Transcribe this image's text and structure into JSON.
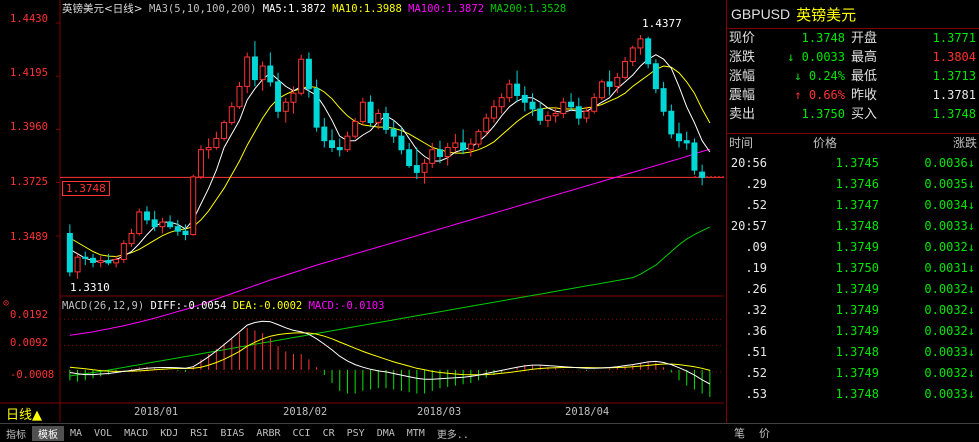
{
  "main_legend": {
    "symbol": "英镑美元",
    "period": "<日线>",
    "ma_params": "MA3(5,10,100,200)",
    "ma5": "MA5:1.3872",
    "ma10": "MA10:1.3988",
    "ma100": "MA100:1.3872",
    "ma200": "MA200:1.3528"
  },
  "y_axis_labels": [
    "1.4430",
    "1.4195",
    "1.3960",
    "1.3725",
    "1.3489"
  ],
  "macd_axis_labels": [
    "0.0192",
    "0.0092",
    "-0.0008"
  ],
  "x_axis_labels": [
    "2018/01",
    "2018/02",
    "2018/03",
    "2018/04"
  ],
  "annotations": {
    "high": "1.4377",
    "low": "1.3310",
    "current_line": "1.3748"
  },
  "macd_legend": {
    "params": "MACD(26,12,9)",
    "diff": "DIFF:-0.0054",
    "dea": "DEA:-0.0002",
    "macd": "MACD:-0.0103"
  },
  "period_label": "日线▲",
  "toolbar": {
    "items": [
      "指标",
      "模板",
      "MA",
      "VOL",
      "MACD",
      "KDJ",
      "RSI",
      "BIAS",
      "ARBR",
      "CCI",
      "CR",
      "PSY",
      "DMA",
      "MTM",
      "更多.."
    ],
    "right": [
      "笔",
      "价"
    ]
  },
  "quote": {
    "code": "GBPUSD",
    "name": "英镑美元",
    "rows": [
      {
        "l1": "现价",
        "v1": "1.3748",
        "c1": "green",
        "l2": "开盘",
        "v2": "1.3771",
        "c2": "green"
      },
      {
        "l1": "涨跌",
        "v1": "↓ 0.0033",
        "c1": "green",
        "l2": "最高",
        "v2": "1.3804",
        "c2": "red"
      },
      {
        "l1": "涨幅",
        "v1": "↓ 0.24%",
        "c1": "green",
        "l2": "最低",
        "v2": "1.3713",
        "c2": "green"
      },
      {
        "l1": "震幅",
        "v1": "↑ 0.66%",
        "c1": "red",
        "l2": "昨收",
        "v2": "1.3781",
        "c2": "white"
      },
      {
        "l1": "卖出",
        "v1": "1.3750",
        "c1": "green",
        "l2": "买入",
        "v2": "1.3748",
        "c2": "green"
      }
    ]
  },
  "tick_header": {
    "time": "时间",
    "price": "价格",
    "change": "涨跌"
  },
  "ticks": [
    {
      "time": "20:56",
      "price": "1.3745",
      "chg": "0.0036↓"
    },
    {
      "time": ".29",
      "price": "1.3746",
      "chg": "0.0035↓"
    },
    {
      "time": ".52",
      "price": "1.3747",
      "chg": "0.0034↓"
    },
    {
      "time": "20:57",
      "price": "1.3748",
      "chg": "0.0033↓"
    },
    {
      "time": ".09",
      "price": "1.3749",
      "chg": "0.0032↓"
    },
    {
      "time": ".19",
      "price": "1.3750",
      "chg": "0.0031↓"
    },
    {
      "time": ".26",
      "price": "1.3749",
      "chg": "0.0032↓"
    },
    {
      "time": ".32",
      "price": "1.3749",
      "chg": "0.0032↓"
    },
    {
      "time": ".36",
      "price": "1.3749",
      "chg": "0.0032↓"
    },
    {
      "time": ".51",
      "price": "1.3748",
      "chg": "0.0033↓"
    },
    {
      "time": ".52",
      "price": "1.3749",
      "chg": "0.0032↓"
    },
    {
      "time": ".53",
      "price": "1.3748",
      "chg": "0.0033↓"
    }
  ],
  "colors": {
    "up": "#ff3232",
    "down": "#00e600",
    "ma5": "#ffffff",
    "ma10": "#ffff00",
    "ma100": "#ff00ff",
    "ma200": "#00cc00",
    "grid": "#800000"
  },
  "chart_data": {
    "type": "candlestick",
    "y_range": [
      1.325,
      1.447
    ],
    "macd_range": [
      -0.013,
      0.022
    ],
    "candles": [
      [
        1.35,
        1.354,
        1.331,
        1.333
      ],
      [
        1.333,
        1.341,
        1.33,
        1.3395
      ],
      [
        1.3395,
        1.342,
        1.336,
        1.339
      ],
      [
        1.339,
        1.341,
        1.335,
        1.3372
      ],
      [
        1.3372,
        1.34,
        1.335,
        1.338
      ],
      [
        1.338,
        1.341,
        1.336,
        1.337
      ],
      [
        1.337,
        1.34,
        1.335,
        1.3385
      ],
      [
        1.3385,
        1.347,
        1.337,
        1.3455
      ],
      [
        1.3455,
        1.352,
        1.344,
        1.35
      ],
      [
        1.35,
        1.361,
        1.349,
        1.3595
      ],
      [
        1.3595,
        1.362,
        1.354,
        1.356
      ],
      [
        1.356,
        1.36,
        1.351,
        1.353
      ],
      [
        1.353,
        1.357,
        1.35,
        1.355
      ],
      [
        1.355,
        1.358,
        1.352,
        1.353
      ],
      [
        1.353,
        1.356,
        1.349,
        1.351
      ],
      [
        1.351,
        1.354,
        1.347,
        1.3495
      ],
      [
        1.3495,
        1.376,
        1.349,
        1.375
      ],
      [
        1.375,
        1.389,
        1.374,
        1.387
      ],
      [
        1.387,
        1.392,
        1.383,
        1.388
      ],
      [
        1.388,
        1.395,
        1.387,
        1.392
      ],
      [
        1.392,
        1.4,
        1.391,
        1.399
      ],
      [
        1.399,
        1.408,
        1.398,
        1.406
      ],
      [
        1.406,
        1.417,
        1.405,
        1.415
      ],
      [
        1.415,
        1.43,
        1.412,
        1.428
      ],
      [
        1.428,
        1.435,
        1.415,
        1.418
      ],
      [
        1.418,
        1.426,
        1.413,
        1.424
      ],
      [
        1.424,
        1.43,
        1.415,
        1.417
      ],
      [
        1.417,
        1.421,
        1.401,
        1.404
      ],
      [
        1.404,
        1.41,
        1.399,
        1.408
      ],
      [
        1.408,
        1.415,
        1.403,
        1.412
      ],
      [
        1.412,
        1.429,
        1.411,
        1.427
      ],
      [
        1.427,
        1.43,
        1.41,
        1.414
      ],
      [
        1.414,
        1.418,
        1.395,
        1.397
      ],
      [
        1.397,
        1.401,
        1.388,
        1.391
      ],
      [
        1.391,
        1.396,
        1.386,
        1.388
      ],
      [
        1.388,
        1.392,
        1.384,
        1.387
      ],
      [
        1.387,
        1.395,
        1.386,
        1.393
      ],
      [
        1.393,
        1.401,
        1.392,
        1.3995
      ],
      [
        1.3995,
        1.41,
        1.398,
        1.408
      ],
      [
        1.408,
        1.411,
        1.397,
        1.399
      ],
      [
        1.399,
        1.405,
        1.396,
        1.403
      ],
      [
        1.403,
        1.406,
        1.394,
        1.396
      ],
      [
        1.396,
        1.4,
        1.39,
        1.393
      ],
      [
        1.393,
        1.397,
        1.385,
        1.387
      ],
      [
        1.387,
        1.39,
        1.379,
        1.38
      ],
      [
        1.38,
        1.388,
        1.374,
        1.377
      ],
      [
        1.377,
        1.383,
        1.372,
        1.381
      ],
      [
        1.381,
        1.39,
        1.379,
        1.387
      ],
      [
        1.387,
        1.391,
        1.381,
        1.384
      ],
      [
        1.384,
        1.39,
        1.38,
        1.388
      ],
      [
        1.388,
        1.394,
        1.386,
        1.39
      ],
      [
        1.39,
        1.396,
        1.385,
        1.387
      ],
      [
        1.387,
        1.392,
        1.384,
        1.3895
      ],
      [
        1.3895,
        1.396,
        1.388,
        1.395
      ],
      [
        1.395,
        1.403,
        1.393,
        1.401
      ],
      [
        1.401,
        1.409,
        1.399,
        1.406
      ],
      [
        1.406,
        1.412,
        1.403,
        1.41
      ],
      [
        1.41,
        1.418,
        1.408,
        1.416
      ],
      [
        1.416,
        1.422,
        1.408,
        1.411
      ],
      [
        1.411,
        1.415,
        1.404,
        1.408
      ],
      [
        1.408,
        1.412,
        1.402,
        1.405
      ],
      [
        1.405,
        1.408,
        1.398,
        1.4
      ],
      [
        1.4,
        1.404,
        1.397,
        1.402
      ],
      [
        1.402,
        1.406,
        1.399,
        1.403
      ],
      [
        1.403,
        1.41,
        1.401,
        1.408
      ],
      [
        1.408,
        1.412,
        1.404,
        1.406
      ],
      [
        1.406,
        1.41,
        1.398,
        1.401
      ],
      [
        1.401,
        1.406,
        1.399,
        1.404
      ],
      [
        1.404,
        1.412,
        1.403,
        1.41
      ],
      [
        1.41,
        1.418,
        1.409,
        1.417
      ],
      [
        1.417,
        1.422,
        1.411,
        1.415
      ],
      [
        1.415,
        1.421,
        1.412,
        1.419
      ],
      [
        1.419,
        1.428,
        1.418,
        1.426
      ],
      [
        1.426,
        1.433,
        1.424,
        1.432
      ],
      [
        1.432,
        1.4377,
        1.429,
        1.436
      ],
      [
        1.436,
        1.437,
        1.423,
        1.425
      ],
      [
        1.425,
        1.427,
        1.412,
        1.414
      ],
      [
        1.414,
        1.417,
        1.402,
        1.404
      ],
      [
        1.404,
        1.407,
        1.392,
        1.394
      ],
      [
        1.394,
        1.399,
        1.388,
        1.391
      ],
      [
        1.391,
        1.395,
        1.387,
        1.39
      ],
      [
        1.39,
        1.392,
        1.376,
        1.378
      ],
      [
        1.3771,
        1.3804,
        1.3713,
        1.3748
      ]
    ],
    "ma5": [
      1.343,
      1.341,
      1.339,
      1.338,
      1.3375,
      1.338,
      1.3385,
      1.34,
      1.342,
      1.3455,
      1.3495,
      1.353,
      1.355,
      1.355,
      1.354,
      1.352,
      1.356,
      1.363,
      1.37,
      1.378,
      1.388,
      1.394,
      1.4,
      1.409,
      1.414,
      1.418,
      1.421,
      1.418,
      1.415,
      1.413,
      1.415,
      1.413,
      1.411,
      1.406,
      1.4,
      1.393,
      1.391,
      1.391,
      1.3935,
      1.3955,
      1.3995,
      1.402,
      1.4,
      1.397,
      1.392,
      1.387,
      1.384,
      1.382,
      1.382,
      1.3835,
      1.386,
      1.387,
      1.388,
      1.3905,
      1.3935,
      1.3975,
      1.402,
      1.406,
      1.4085,
      1.41,
      1.41,
      1.408,
      1.4055,
      1.404,
      1.4035,
      1.4045,
      1.404,
      1.404,
      1.406,
      1.408,
      1.41,
      1.414,
      1.417,
      1.42,
      1.424,
      1.427,
      1.429,
      1.427,
      1.423,
      1.415,
      1.406,
      1.399,
      1.391,
      1.386
    ],
    "ma10": [
      1.348,
      1.346,
      1.344,
      1.342,
      1.3405,
      1.34,
      1.3398,
      1.3405,
      1.3415,
      1.343,
      1.345,
      1.347,
      1.349,
      1.3505,
      1.3515,
      1.352,
      1.353,
      1.356,
      1.36,
      1.365,
      1.37,
      1.376,
      1.382,
      1.389,
      1.395,
      1.401,
      1.406,
      1.4095,
      1.4115,
      1.413,
      1.414,
      1.415,
      1.4145,
      1.4125,
      1.4095,
      1.4055,
      1.402,
      1.3995,
      1.398,
      1.3975,
      1.397,
      1.397,
      1.3965,
      1.3955,
      1.394,
      1.392,
      1.39,
      1.388,
      1.387,
      1.386,
      1.3855,
      1.3855,
      1.386,
      1.387,
      1.3885,
      1.3905,
      1.3935,
      1.3965,
      1.3995,
      1.402,
      1.404,
      1.405,
      1.4055,
      1.4055,
      1.405,
      1.405,
      1.405,
      1.4055,
      1.406,
      1.407,
      1.4085,
      1.41,
      1.412,
      1.415,
      1.4175,
      1.42,
      1.4225,
      1.424,
      1.4235,
      1.421,
      1.417,
      1.412,
      1.405,
      1.3988
    ],
    "ma100": [
      1.305,
      1.3055,
      1.306,
      1.3065,
      1.3072,
      1.3078,
      1.3085,
      1.3092,
      1.31,
      1.3108,
      1.3117,
      1.3126,
      1.3135,
      1.3145,
      1.3155,
      1.3164,
      1.3175,
      1.3187,
      1.3198,
      1.321,
      1.3222,
      1.3234,
      1.3246,
      1.3258,
      1.327,
      1.3282,
      1.3294,
      1.3305,
      1.3316,
      1.3327,
      1.3338,
      1.3349,
      1.336,
      1.337,
      1.338,
      1.339,
      1.34,
      1.341,
      1.342,
      1.343,
      1.344,
      1.345,
      1.346,
      1.347,
      1.348,
      1.349,
      1.35,
      1.351,
      1.352,
      1.353,
      1.354,
      1.355,
      1.356,
      1.357,
      1.358,
      1.359,
      1.36,
      1.361,
      1.362,
      1.363,
      1.364,
      1.365,
      1.366,
      1.367,
      1.368,
      1.369,
      1.37,
      1.371,
      1.372,
      1.373,
      1.374,
      1.375,
      1.376,
      1.377,
      1.378,
      1.379,
      1.38,
      1.381,
      1.382,
      1.383,
      1.384,
      1.3852,
      1.3862,
      1.3872
    ],
    "ma200": [
      1.287,
      1.2875,
      1.288,
      1.2885,
      1.289,
      1.2896,
      1.2902,
      1.2908,
      1.2914,
      1.292,
      1.2926,
      1.2932,
      1.2938,
      1.2944,
      1.295,
      1.2956,
      1.2962,
      1.2968,
      1.2974,
      1.298,
      1.2986,
      1.2992,
      1.2998,
      1.3004,
      1.301,
      1.3016,
      1.3022,
      1.3028,
      1.3034,
      1.304,
      1.3046,
      1.3052,
      1.3058,
      1.3064,
      1.307,
      1.3076,
      1.3082,
      1.3088,
      1.3094,
      1.31,
      1.3106,
      1.3112,
      1.3118,
      1.3124,
      1.313,
      1.3136,
      1.3142,
      1.3148,
      1.3154,
      1.316,
      1.3166,
      1.3172,
      1.3178,
      1.3184,
      1.319,
      1.3196,
      1.3202,
      1.3208,
      1.3214,
      1.322,
      1.3226,
      1.3232,
      1.3238,
      1.3244,
      1.325,
      1.3256,
      1.3262,
      1.3268,
      1.3274,
      1.328,
      1.3286,
      1.3292,
      1.3298,
      1.3305,
      1.332,
      1.334,
      1.336,
      1.339,
      1.342,
      1.345,
      1.3475,
      1.3495,
      1.3512,
      1.3528
    ],
    "macd_bars": [
      -0.004,
      -0.0045,
      -0.004,
      -0.0032,
      -0.0025,
      -0.0018,
      -0.001,
      -0.0002,
      0.0004,
      0.001,
      0.0012,
      0.0008,
      0.0004,
      0.0,
      -0.0004,
      -0.0008,
      0.0012,
      0.004,
      0.006,
      0.008,
      0.01,
      0.012,
      0.014,
      0.016,
      0.015,
      0.014,
      0.012,
      0.009,
      0.007,
      0.006,
      0.006,
      0.004,
      0.001,
      -0.002,
      -0.005,
      -0.008,
      -0.009,
      -0.009,
      -0.008,
      -0.0075,
      -0.007,
      -0.007,
      -0.0075,
      -0.008,
      -0.0085,
      -0.009,
      -0.009,
      -0.008,
      -0.007,
      -0.0065,
      -0.006,
      -0.0055,
      -0.005,
      -0.004,
      -0.003,
      -0.002,
      -0.001,
      0.0,
      0.001,
      0.0018,
      0.002,
      0.0016,
      0.001,
      0.0006,
      0.0002,
      0.0,
      -0.0002,
      -0.0004,
      -0.0002,
      0.0,
      0.0004,
      0.0008,
      0.0014,
      0.002,
      0.0026,
      0.003,
      0.0028,
      0.001,
      -0.001,
      -0.004,
      -0.006,
      -0.0075,
      -0.009,
      -0.0103
    ],
    "diff": [
      -0.001,
      -0.0015,
      -0.0018,
      -0.0018,
      -0.0016,
      -0.0014,
      -0.001,
      -0.0006,
      -0.0002,
      0.0002,
      0.0006,
      0.0008,
      0.0009,
      0.0009,
      0.0008,
      0.0006,
      0.0012,
      0.003,
      0.005,
      0.0072,
      0.0096,
      0.012,
      0.0145,
      0.017,
      0.018,
      0.0185,
      0.0183,
      0.0172,
      0.016,
      0.015,
      0.0145,
      0.0135,
      0.0118,
      0.0098,
      0.0076,
      0.0052,
      0.0034,
      0.002,
      0.001,
      0.0002,
      -0.0004,
      -0.0008,
      -0.0014,
      -0.002,
      -0.0026,
      -0.0032,
      -0.0036,
      -0.0036,
      -0.0034,
      -0.0032,
      -0.003,
      -0.0028,
      -0.0025,
      -0.002,
      -0.0014,
      -0.0008,
      -0.0002,
      0.0004,
      0.001,
      0.0015,
      0.0018,
      0.0018,
      0.0016,
      0.0014,
      0.0012,
      0.001,
      0.0008,
      0.0006,
      0.0006,
      0.0007,
      0.0009,
      0.0012,
      0.0016,
      0.002,
      0.0025,
      0.003,
      0.0032,
      0.0028,
      0.002,
      0.0008,
      -0.0005,
      -0.002,
      -0.0038,
      -0.0054
    ],
    "dea": [
      0.001,
      0.0007,
      0.0004,
      0.0,
      -0.0003,
      -0.0005,
      -0.0006,
      -0.0006,
      -0.0005,
      -0.0004,
      -0.0002,
      0.0,
      0.0002,
      0.0004,
      0.0005,
      0.0005,
      0.0006,
      0.001,
      0.0018,
      0.0028,
      0.004,
      0.0055,
      0.007,
      0.009,
      0.0105,
      0.0118,
      0.0128,
      0.0134,
      0.0138,
      0.014,
      0.0141,
      0.014,
      0.0136,
      0.0128,
      0.0118,
      0.0106,
      0.0094,
      0.0082,
      0.007,
      0.006,
      0.005,
      0.004,
      0.003,
      0.0022,
      0.0014,
      0.0006,
      0.0,
      -0.0006,
      -0.001,
      -0.0013,
      -0.0016,
      -0.0018,
      -0.0019,
      -0.0019,
      -0.0018,
      -0.0016,
      -0.0013,
      -0.001,
      -0.0006,
      -0.0002,
      0.0002,
      0.0005,
      0.0007,
      0.0008,
      0.0009,
      0.0009,
      0.0009,
      0.0009,
      0.0008,
      0.0008,
      0.0008,
      0.0009,
      0.001,
      0.0012,
      0.0014,
      0.0017,
      0.002,
      0.0022,
      0.0022,
      0.002,
      0.0016,
      0.0012,
      0.0006,
      -0.0002
    ]
  }
}
